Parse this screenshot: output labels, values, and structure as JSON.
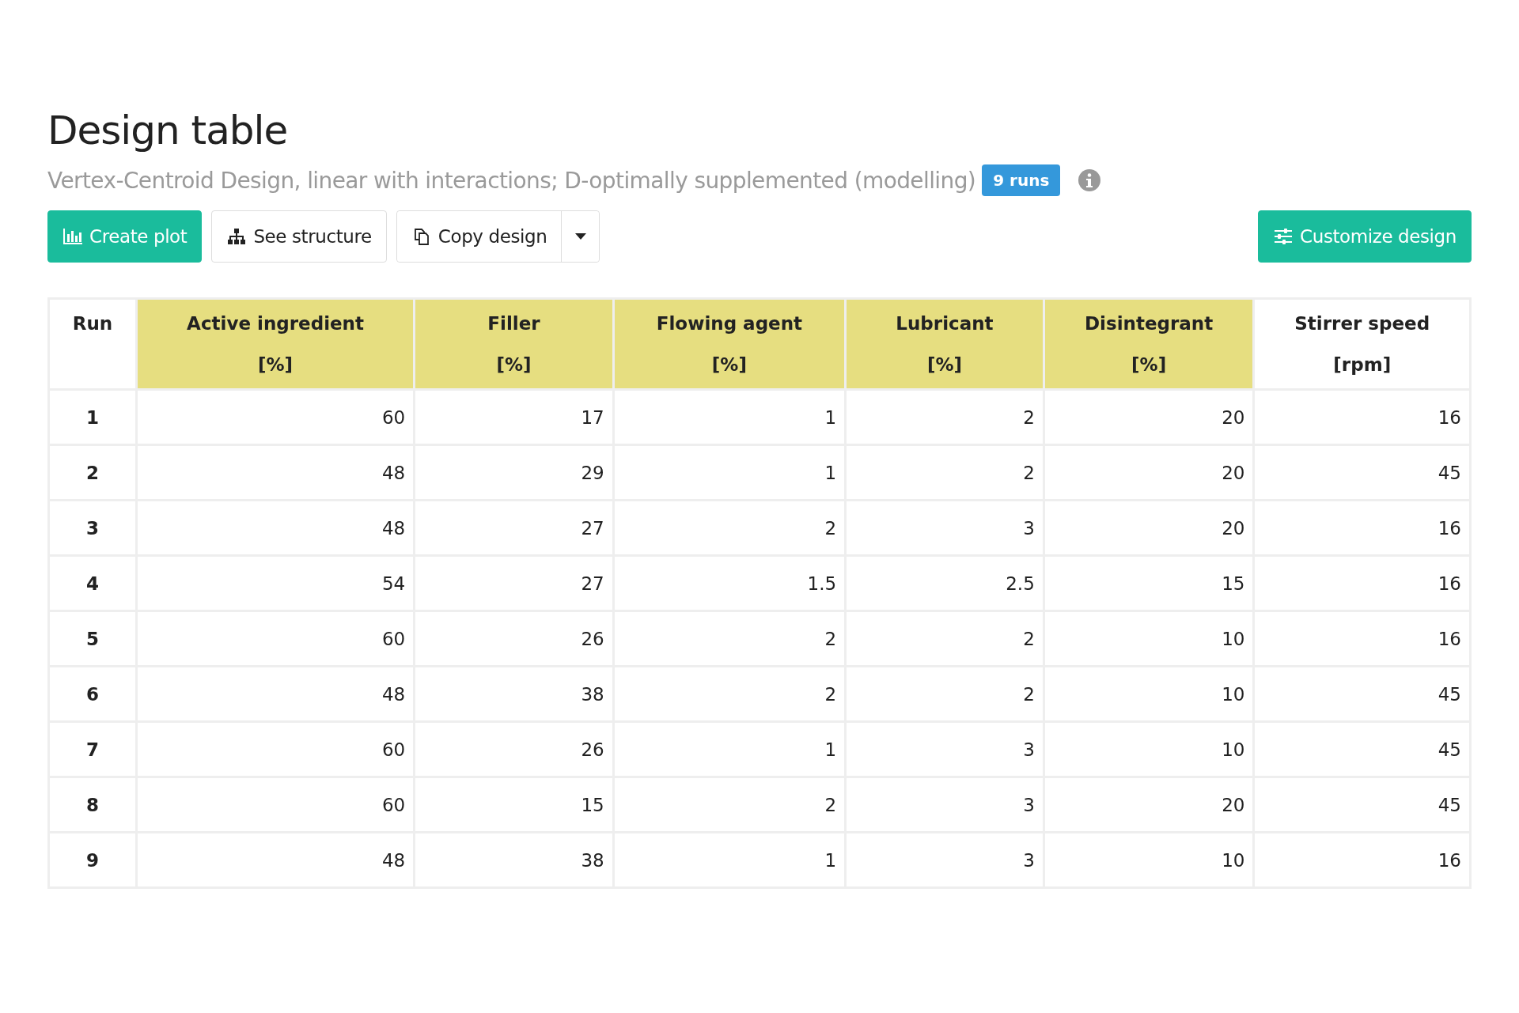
{
  "title": "Design table",
  "subtitle": "Vertex-Centroid Design, linear with interactions; D-optimally supplemented (modelling)",
  "runs_badge": "9 runs",
  "buttons": [
    {
      "label": "Create plot",
      "kind": "primary"
    },
    {
      "label": "See structure",
      "kind": "default"
    },
    {
      "label": "Copy design",
      "kind": "split"
    }
  ],
  "customize_button": {
    "label": "Customize design"
  },
  "table": {
    "columns": [
      {
        "name": "Run",
        "highlighted": false
      },
      {
        "name": "Active ingredient",
        "unit": "[%]",
        "highlighted": true
      },
      {
        "name": "Filler",
        "unit": "[%]",
        "highlighted": true
      },
      {
        "name": "Flowing agent",
        "unit": "[%]",
        "highlighted": true
      },
      {
        "name": "Lubricant",
        "unit": "[%]",
        "highlighted": true
      },
      {
        "name": "Disintegrant",
        "unit": "[%]",
        "highlighted": true
      },
      {
        "name": "Stirrer speed",
        "unit": "[rpm]",
        "highlighted": false
      }
    ],
    "rows": [
      [
        "1",
        "60",
        "17",
        "1",
        "2",
        "20",
        "16"
      ],
      [
        "2",
        "48",
        "29",
        "1",
        "2",
        "20",
        "45"
      ],
      [
        "3",
        "48",
        "27",
        "2",
        "3",
        "20",
        "16"
      ],
      [
        "4",
        "54",
        "27",
        "1.5",
        "2.5",
        "15",
        "16"
      ],
      [
        "5",
        "60",
        "26",
        "2",
        "2",
        "10",
        "16"
      ],
      [
        "6",
        "48",
        "38",
        "2",
        "2",
        "10",
        "45"
      ],
      [
        "7",
        "60",
        "26",
        "1",
        "3",
        "10",
        "45"
      ],
      [
        "8",
        "60",
        "15",
        "2",
        "3",
        "20",
        "45"
      ],
      [
        "9",
        "48",
        "38",
        "1",
        "3",
        "10",
        "16"
      ]
    ]
  }
}
